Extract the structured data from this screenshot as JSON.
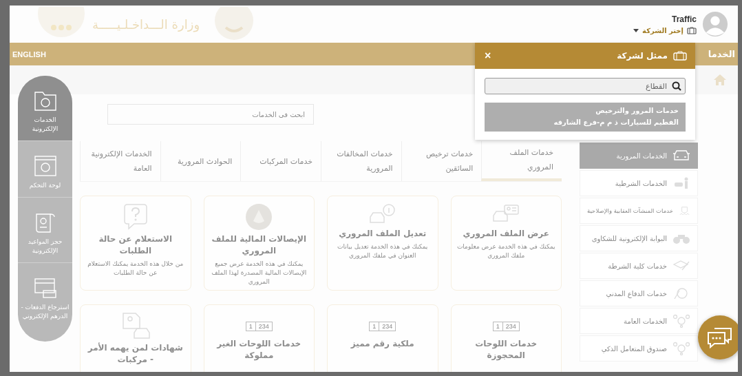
{
  "header": {
    "logo_text": "وزارة الـــداخـلـيـــــة",
    "user_name": "Traffic",
    "company_select": "إختر الشركة"
  },
  "nav": {
    "current": "الخدما",
    "language": "ENGLISH"
  },
  "rail": [
    {
      "label": "الخدمات الإلكترونية",
      "kind": "folder",
      "selected": true
    },
    {
      "label": "لوحة التحكم",
      "kind": "dashboard",
      "selected": false
    },
    {
      "label": "حجز المواعيد الإلكترونية",
      "kind": "scroll",
      "selected": false
    },
    {
      "label": "استرجاع الدفعات - الدرهم الإلكتروني",
      "kind": "card",
      "selected": false
    }
  ],
  "search": {
    "placeholder": "ابحث في الخدمات"
  },
  "tabs": [
    {
      "label": "خدمات الملف المروري",
      "selected": true
    },
    {
      "label": "خدمات ترخيص السائقين",
      "selected": false
    },
    {
      "label": "خدمات المخالفات المرورية",
      "selected": false
    },
    {
      "label": "خدمات المركبات",
      "selected": false
    },
    {
      "label": "الحوادث المرورية",
      "selected": false
    },
    {
      "label": "الخدمات الإلكترونية العامة",
      "selected": false
    }
  ],
  "cards": [
    {
      "title": "عرض الملف المروري",
      "description": "يمكنك في هذه الخدمة عرض معلومات ملفك المروري",
      "kind": "file-view"
    },
    {
      "title": "تعديل الملف المروري",
      "description": "يمكنك في هذه الخدمة تعديل بيانات العنوان في ملفك المروري",
      "kind": "file-edit"
    },
    {
      "title": "الإيصالات المالية للملف المروري",
      "description": "يمكنك في هذه الخدمة عرض جميع الإيصالات المالية المصدرة لهذا الملف المروري",
      "kind": "emblem"
    },
    {
      "title": "الاستعلام عن حالة الطلبات",
      "description": "من خلال هذه الخدمة يمكنك الاستعلام عن حالة الطلبات",
      "kind": "question"
    },
    {
      "title": "خدمات اللوحات المحجوزة",
      "kind": "plate",
      "plate": [
        "234",
        "1"
      ]
    },
    {
      "title": "ملكية رقم مميز",
      "kind": "plate",
      "plate": [
        "234",
        "1"
      ]
    },
    {
      "title": "خدمات اللوحات الغير مملوكة",
      "kind": "plate",
      "plate": [
        "234",
        "1"
      ]
    },
    {
      "title": "شهادات لمن يهمه الأمر - مركبات",
      "kind": "certificate"
    }
  ],
  "sidebar": [
    {
      "label": "الخدمات المرورية",
      "kind": "car",
      "selected": true
    },
    {
      "label": "الخدمات الشرطية",
      "kind": "police",
      "selected": false
    },
    {
      "label": "خدمات المنشآت العقابية والإصلاحية",
      "kind": "guard",
      "selected": false
    },
    {
      "label": "البوابة الإلكترونية للشكاوى",
      "kind": "bike",
      "selected": false
    },
    {
      "label": "خدمات كلية الشرطة",
      "kind": "graduation",
      "selected": false
    },
    {
      "label": "خدمات الدفاع المدني",
      "kind": "shield",
      "selected": false
    },
    {
      "label": "الخدمات العامة",
      "kind": "network",
      "selected": false
    },
    {
      "label": "صندوق المتعامل الذكي",
      "kind": "network",
      "selected": false
    }
  ],
  "popup": {
    "title": "ممثل لشركة",
    "close": "×",
    "search_value": "القطاع",
    "results": [
      "خدمات المرور والترخيص",
      "الفطيم للسيارات ذ م م-فرع الشارقه"
    ]
  }
}
